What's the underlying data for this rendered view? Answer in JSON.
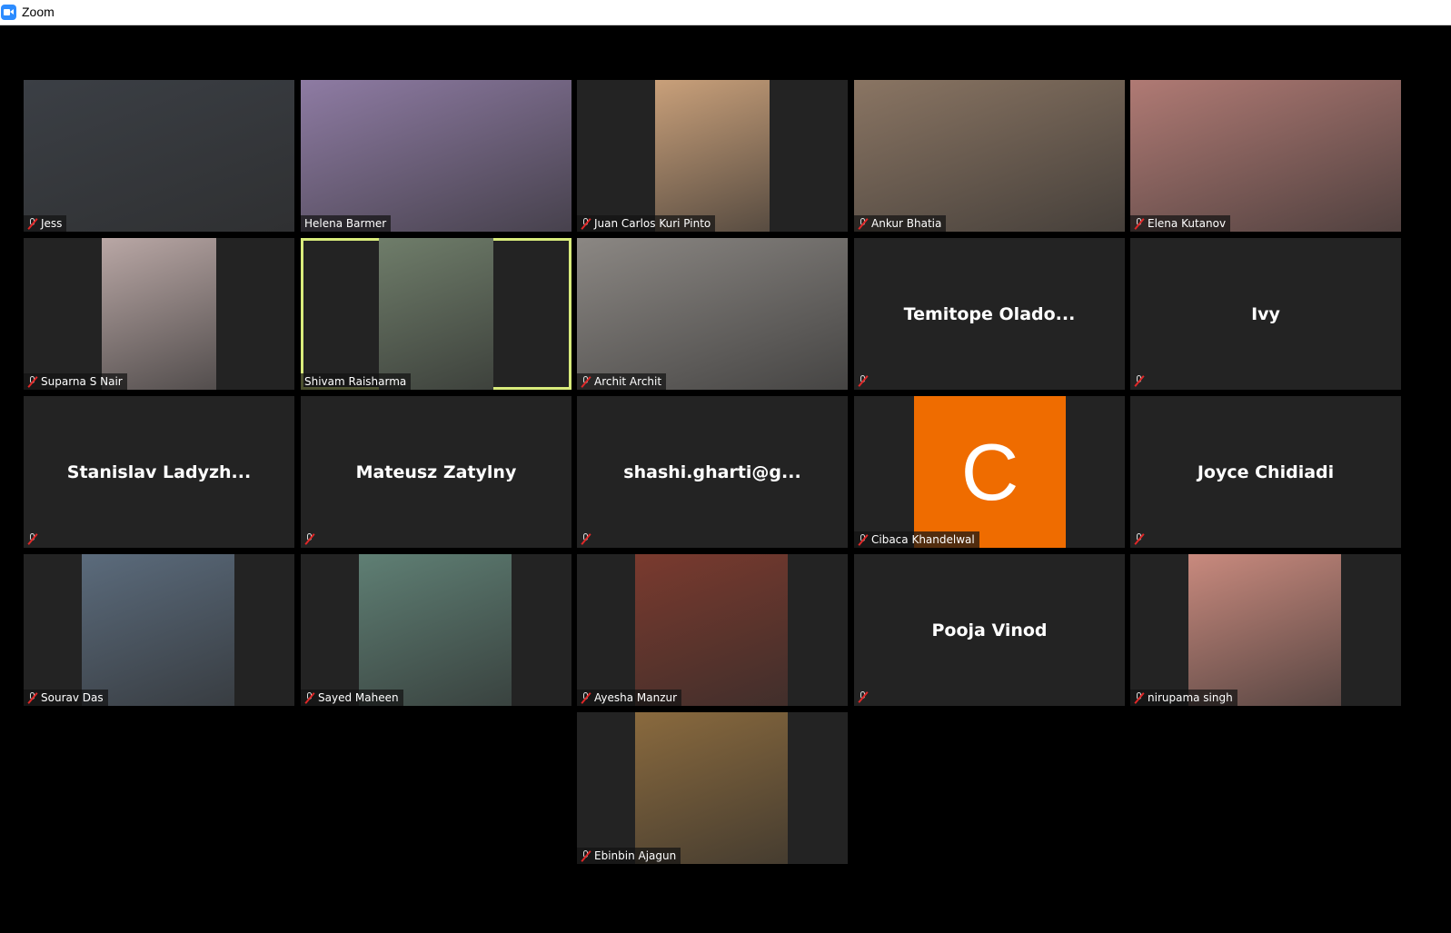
{
  "window": {
    "title": "Zoom",
    "icon": "zoom-camera-icon"
  },
  "participants": [
    {
      "name": "Jess",
      "video": true,
      "muted": true,
      "color": "#3b3f45"
    },
    {
      "name": "Helena Barmer",
      "video": true,
      "muted": false,
      "color": "#8e7ba3"
    },
    {
      "name": "Juan Carlos Kuri Pinto",
      "video": true,
      "muted": true,
      "color": "#c9a07a"
    },
    {
      "name": "Ankur Bhatia",
      "video": true,
      "muted": true,
      "color": "#8a7563"
    },
    {
      "name": "Elena Kutanov",
      "video": true,
      "muted": true,
      "color": "#b07a74"
    },
    {
      "name": "Suparna S Nair",
      "video": true,
      "muted": true,
      "color": "#b9a7a5"
    },
    {
      "name": "Shivam Raisharma",
      "video": true,
      "muted": false,
      "color": "#6f7d6a",
      "active_speaker": true
    },
    {
      "name": "Archit Archit",
      "video": true,
      "muted": true,
      "color": "#8b8783"
    },
    {
      "name": "Temitope  Olado...",
      "video": false,
      "muted": true
    },
    {
      "name": "Ivy",
      "video": false,
      "muted": true
    },
    {
      "name": "Stanislav  Ladyzh...",
      "video": false,
      "muted": true
    },
    {
      "name": "Mateusz Zatylny",
      "video": false,
      "muted": true
    },
    {
      "name": "shashi.gharti@g...",
      "video": false,
      "muted": true
    },
    {
      "name": "Cibaca Khandelwal",
      "video": false,
      "muted": true,
      "avatar_letter": "C",
      "avatar_color": "#ef6c00"
    },
    {
      "name": "Joyce Chidiadi",
      "video": false,
      "muted": true
    },
    {
      "name": "Sourav Das",
      "video": true,
      "muted": true,
      "color": "#5b6b7c"
    },
    {
      "name": "Sayed Maheen",
      "video": true,
      "muted": true,
      "color": "#5f7f74"
    },
    {
      "name": "Ayesha Manzur",
      "video": true,
      "muted": true,
      "color": "#7a3a2e"
    },
    {
      "name": "Pooja Vinod",
      "video": false,
      "muted": true
    },
    {
      "name": "nirupama singh",
      "video": true,
      "muted": true,
      "color": "#c98a7e"
    },
    {
      "name": "Ebinbin Ajagun",
      "video": true,
      "muted": true,
      "color": "#8a6a3e"
    }
  ]
}
